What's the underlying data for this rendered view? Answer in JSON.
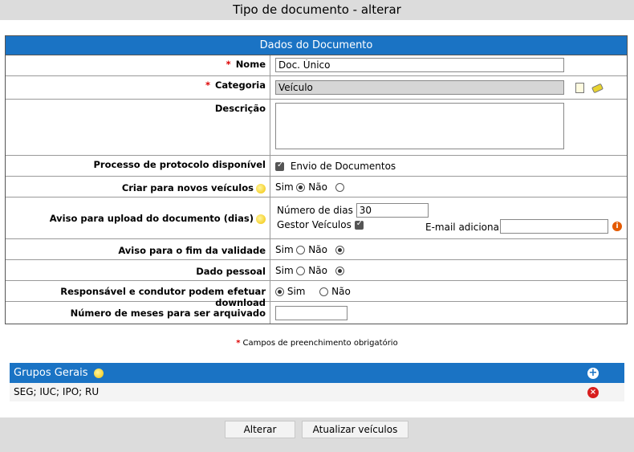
{
  "window": {
    "title": "Tipo de documento - alterar"
  },
  "form": {
    "header": "Dados do Documento",
    "required_mark": "*",
    "nome": {
      "label": "Nome",
      "value": "Doc. Único"
    },
    "categoria": {
      "label": "Categoria",
      "value": "Veículo"
    },
    "descricao": {
      "label": "Descrição",
      "value": ""
    },
    "processo": {
      "label": "Processo de protocolo disponível",
      "option": "Envio de Documentos"
    },
    "criar_novos": {
      "label": "Criar para novos veículos",
      "sim": "Sim",
      "nao": "Não",
      "selected": "nao"
    },
    "aviso_upload": {
      "label": "Aviso para upload do documento (dias)",
      "numero_dias_label": "Número de dias",
      "numero_dias_value": "30",
      "gestor_label": "Gestor Veículos",
      "email_label": "E-mail adicional",
      "email_value": ""
    },
    "aviso_validade": {
      "label": "Aviso para o fim da validade",
      "sim": "Sim",
      "nao": "Não",
      "selected": "nao"
    },
    "dado_pessoal": {
      "label": "Dado pessoal",
      "sim": "Sim",
      "nao": "Não",
      "selected": "nao"
    },
    "download": {
      "label": "Responsável e condutor podem efetuar download",
      "sim": "Sim",
      "nao": "Não",
      "selected": "sim"
    },
    "meses_arquivo": {
      "label": "Número de meses para ser arquivado",
      "value": ""
    }
  },
  "footnote": "Campos de preenchimento obrigatório",
  "groups": {
    "title": "Grupos Gerais",
    "row": "SEG; IUC; IPO; RU"
  },
  "buttons": {
    "alterar": "Alterar",
    "atualizar": "Atualizar veículos"
  },
  "colors": {
    "header_blue": "#1a73c4",
    "required_red": "#d00000",
    "bar_gray": "#dcdcdc"
  },
  "icons": [
    "lightbulb-icon",
    "info-icon",
    "plus-icon",
    "remove-icon",
    "document-icon",
    "eraser-icon"
  ]
}
